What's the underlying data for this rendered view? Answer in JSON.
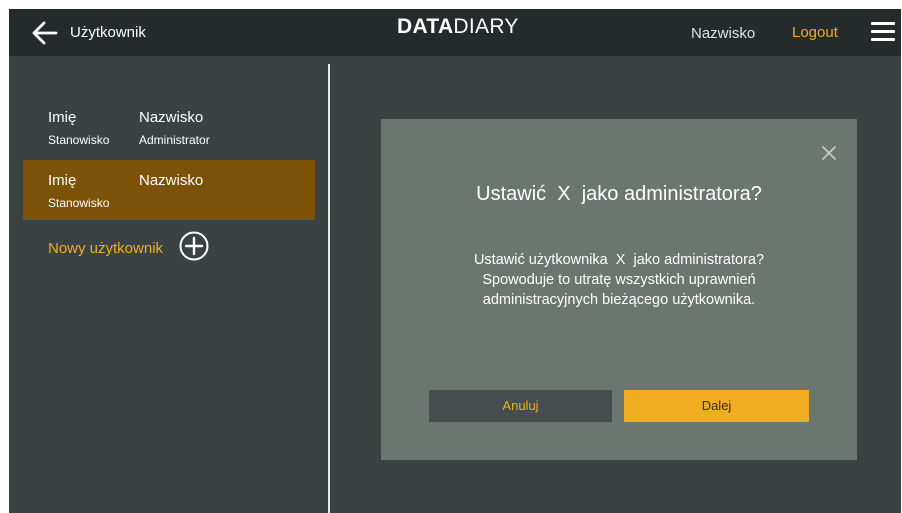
{
  "header": {
    "title": "Użytkownik",
    "logo_bold": "DATA",
    "logo_light": "DIARY",
    "user_name": "Nazwisko",
    "logout_label": "Logout"
  },
  "users": [
    {
      "first_name": "Imię",
      "last_name": "Nazwisko",
      "position": "Stanowisko",
      "role": "Administrator",
      "selected": false
    },
    {
      "first_name": "Imię",
      "last_name": "Nazwisko",
      "position": "Stanowisko",
      "role": "",
      "selected": true
    }
  ],
  "new_user_label": "Nowy użytkownik",
  "dialog": {
    "title": "Ustawić  X  jako administratora?",
    "body_lines": [
      "Ustawić użytkownika  X  jako administratora?",
      "Spowoduje to utratę wszystkich uprawnień",
      "administracyjnych bieżącego użytkownika."
    ],
    "cancel_label": "Anuluj",
    "confirm_label": "Dalej"
  },
  "colors": {
    "accent": "#f0ad22",
    "selected_row": "#7c5208",
    "topbar": "#252a2a",
    "background": "#3b4242",
    "dialog": "#6c7671"
  },
  "icons": {
    "back": "arrow-left-icon",
    "menu": "hamburger-menu-icon",
    "add": "plus-circle-icon",
    "close": "close-icon"
  }
}
